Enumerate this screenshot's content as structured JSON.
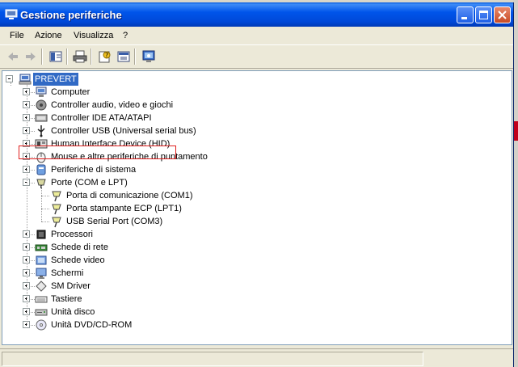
{
  "window": {
    "title": "Gestione periferiche"
  },
  "menu": [
    "File",
    "Azione",
    "Visualizza",
    "?"
  ],
  "tree": {
    "root": "PREVERT",
    "items": [
      {
        "label": "Computer",
        "icon": "computer-icon",
        "expanded": false
      },
      {
        "label": "Controller audio, video e giochi",
        "icon": "audio-icon",
        "expanded": false
      },
      {
        "label": "Controller IDE ATA/ATAPI",
        "icon": "ide-controller-icon",
        "expanded": false
      },
      {
        "label": "Controller USB (Universal serial bus)",
        "icon": "usb-icon",
        "expanded": false
      },
      {
        "label": "Human Interface Device (HID)",
        "icon": "hid-icon",
        "expanded": false
      },
      {
        "label": "Mouse e altre periferiche di puntamento",
        "icon": "mouse-icon",
        "expanded": false
      },
      {
        "label": "Periferiche di sistema",
        "icon": "system-device-icon",
        "expanded": false
      },
      {
        "label": "Porte (COM e LPT)",
        "icon": "port-icon",
        "expanded": true,
        "children": [
          "Porta di comunicazione (COM1)",
          "Porta stampante ECP (LPT1)",
          "USB Serial Port (COM3)"
        ]
      },
      {
        "label": "Processori",
        "icon": "processor-icon",
        "expanded": false
      },
      {
        "label": "Schede di rete",
        "icon": "network-card-icon",
        "expanded": false
      },
      {
        "label": "Schede video",
        "icon": "display-adapter-icon",
        "expanded": false
      },
      {
        "label": "Schermi",
        "icon": "monitor-icon",
        "expanded": false
      },
      {
        "label": "SM Driver",
        "icon": "sm-driver-icon",
        "expanded": false
      },
      {
        "label": "Tastiere",
        "icon": "keyboard-icon",
        "expanded": false
      },
      {
        "label": "Unità disco",
        "icon": "disk-drive-icon",
        "expanded": false
      },
      {
        "label": "Unità DVD/CD-ROM",
        "icon": "dvd-drive-icon",
        "expanded": false
      }
    ]
  },
  "highlighted_item": "USB Serial Port (COM3)",
  "colors": {
    "titlebar": "#0055ea",
    "selection": "#316ac5",
    "highlight_box": "#e0201f"
  }
}
